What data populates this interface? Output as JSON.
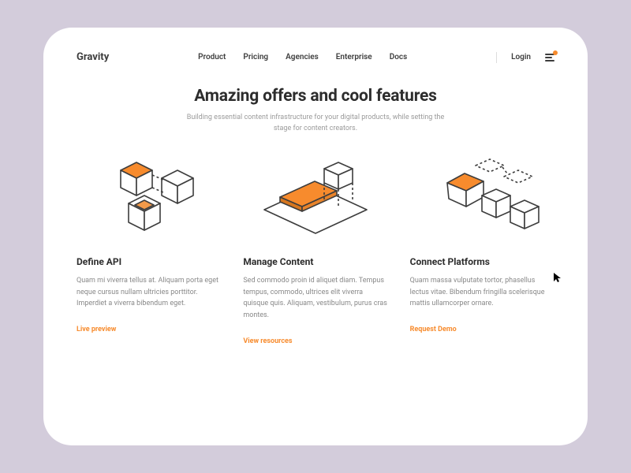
{
  "brand": "Gravity",
  "nav": {
    "items": [
      "Product",
      "Pricing",
      "Agencies",
      "Enterprise",
      "Docs"
    ],
    "login": "Login"
  },
  "hero": {
    "title": "Amazing offers and cool features",
    "subtitle": "Building essential content infrastructure for your digital products, while setting the stage for content creators."
  },
  "features": [
    {
      "title": "Define API",
      "body": "Quam mi viverra tellus at. Aliquam porta eget neque cursus nullam ultricies porttitor. Imperdiet a viverra bibendum eget.",
      "cta": "Live preview"
    },
    {
      "title": "Manage Content",
      "body": "Sed commodo proin id aliquet diam. Tempus tempus, commodo, ultrices elit viverra quisque quis. Aliquam, vestibulum, purus cras montes.",
      "cta": "View resources"
    },
    {
      "title": "Connect Platforms",
      "body": "Quam massa vulputate tortor, phasellus lectus vitae. Bibendum fringilla scelerisque mattis ullamcorper ornare.",
      "cta": "Request Demo"
    }
  ],
  "colors": {
    "accent": "#f78b2d",
    "text": "#2d2d2d",
    "muted": "#9a9a9a",
    "pageBg": "#d3ccdb"
  }
}
